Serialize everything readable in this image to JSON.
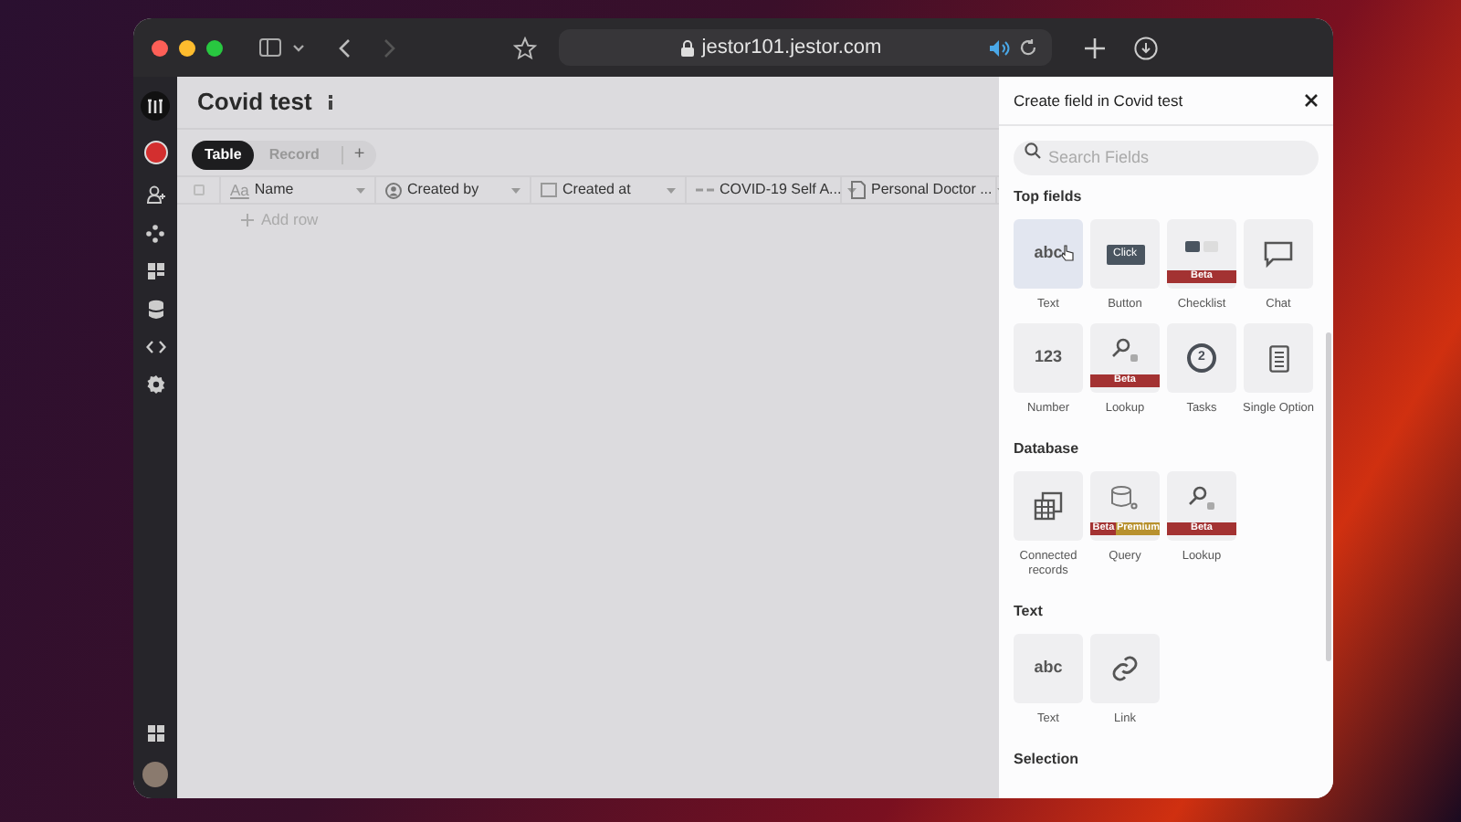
{
  "browser": {
    "url": "jestor101.jestor.com"
  },
  "page": {
    "title": "Covid test",
    "views": [
      {
        "label": "Table",
        "selected": true
      },
      {
        "label": "Record",
        "selected": false
      }
    ],
    "add_view": "+"
  },
  "table": {
    "select_all": {
      "checked": false
    },
    "columns": [
      {
        "label": "Name",
        "kind": "text",
        "type_glyph": "Aa"
      },
      {
        "label": "Created by",
        "kind": "user"
      },
      {
        "label": "Created at",
        "kind": "date"
      },
      {
        "label": "COVID-19 Self A...",
        "kind": "link"
      },
      {
        "label": "Personal Doctor ...",
        "kind": "document"
      }
    ],
    "add_row": "Add row"
  },
  "panel": {
    "title": "Create field in Covid test",
    "search": {
      "placeholder": "Search Fields"
    },
    "sections": [
      {
        "title": "Top fields",
        "fields": [
          {
            "label": "Text",
            "kind": "text",
            "glyph": "abc",
            "hovered": true
          },
          {
            "label": "Button",
            "kind": "button",
            "glyph": "Click",
            "hovered": false
          },
          {
            "label": "Checklist",
            "kind": "checklist",
            "hovered": false,
            "badges": [
              {
                "label": "Beta",
                "kind": "beta"
              }
            ]
          },
          {
            "label": "Chat",
            "kind": "chat",
            "hovered": false
          },
          {
            "label": "Number",
            "kind": "number",
            "glyph": "123",
            "hovered": false
          },
          {
            "label": "Lookup",
            "kind": "lookup",
            "hovered": false,
            "badges": [
              {
                "label": "Beta",
                "kind": "beta"
              }
            ]
          },
          {
            "label": "Tasks",
            "kind": "tasks",
            "glyph": "2",
            "hovered": false
          },
          {
            "label": "Single Option",
            "kind": "option",
            "hovered": false
          }
        ]
      },
      {
        "title": "Database",
        "fields": [
          {
            "label": "Connected records",
            "kind": "records",
            "hovered": false
          },
          {
            "label": "Query",
            "kind": "query",
            "hovered": false,
            "badges": [
              {
                "label": "Beta",
                "kind": "beta"
              },
              {
                "label": "Premium",
                "kind": "premium"
              }
            ]
          },
          {
            "label": "Lookup",
            "kind": "lookup",
            "hovered": false,
            "badges": [
              {
                "label": "Beta",
                "kind": "beta"
              }
            ]
          }
        ]
      },
      {
        "title": "Text",
        "fields": [
          {
            "label": "Text",
            "kind": "text",
            "glyph": "abc",
            "hovered": false
          },
          {
            "label": "Link",
            "kind": "link",
            "hovered": false
          }
        ]
      },
      {
        "title": "Selection"
      }
    ]
  }
}
